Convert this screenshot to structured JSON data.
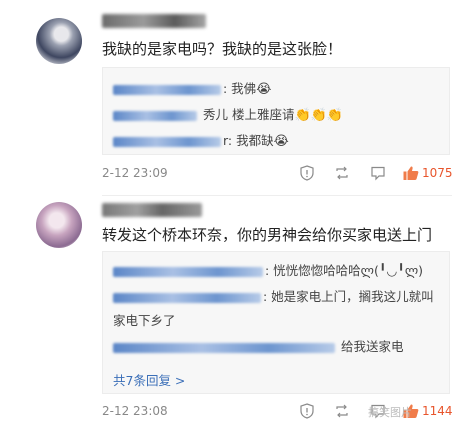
{
  "comments": [
    {
      "text": "我缺的是家电吗？我缺的是这张脸！",
      "replies": [
        {
          "text": ": 我佛",
          "emoji": "😭"
        },
        {
          "text": "秀儿 楼上雅座请",
          "emoji": "👏👏👏"
        },
        {
          "text": "r: 我都缺",
          "emoji": "😭"
        }
      ],
      "time": "2-12 23:09",
      "likes": "1075"
    },
    {
      "text": "转发这个桥本环奈，你的男神会给你买家电送上门",
      "replies": [
        {
          "text": ": 恍恍惚惚哈哈哈ლ(╹◡╹ლ)"
        },
        {
          "text": ": 她是家电上门，搁我这儿就叫",
          "text2": "家电下乡了"
        },
        {
          "text": "给我送家电"
        }
      ],
      "more_replies": "共7条回复 >",
      "time": "2-12 23:08",
      "likes": "1144"
    }
  ],
  "watermark": "搞笑图片",
  "colors": {
    "accent": "#e8552c",
    "link": "#3b6fb8"
  }
}
